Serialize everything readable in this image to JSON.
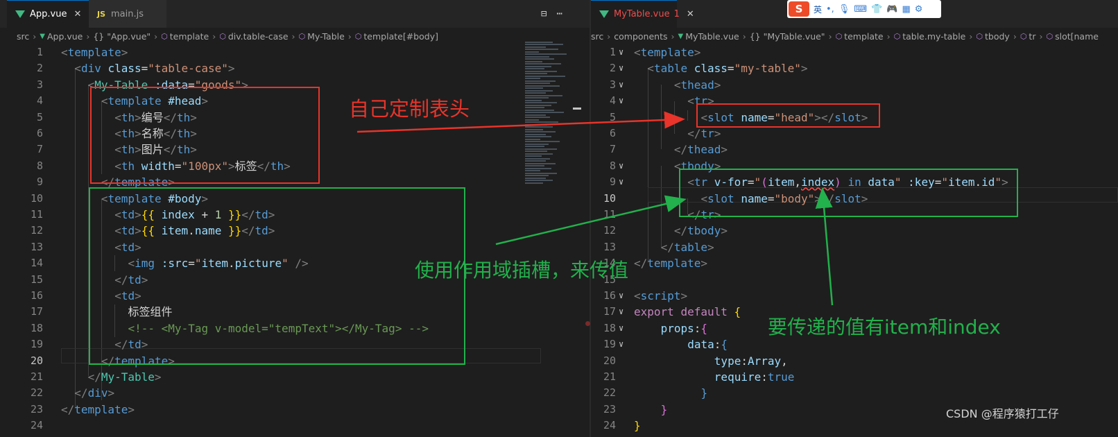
{
  "left": {
    "tabs": [
      {
        "label": "App.vue",
        "active": true,
        "close": "✕"
      },
      {
        "label": "main.js",
        "active": false
      }
    ],
    "breadcrumbs": [
      "src",
      "App.vue",
      "{} \"App.vue\"",
      "template",
      "div.table-case",
      "My-Table",
      "template[#body]"
    ],
    "current_line": 20
  },
  "right": {
    "tabs": [
      {
        "label": "MyTable.vue",
        "badge": "1",
        "active": true,
        "close": "✕"
      }
    ],
    "breadcrumbs": [
      "src",
      "components",
      "MyTable.vue",
      "{} \"MyTable.vue\"",
      "template",
      "table.my-table",
      "tbody",
      "tr",
      "slot[name"
    ],
    "current_line": 10
  },
  "annotations": {
    "head_label": "自己定制表头",
    "scope_label": "使用作用域插槽，来传值",
    "values_label": "要传递的值有item和index"
  },
  "watermark": "CSDN @程序猿打工仔",
  "ime": {
    "lang": "英",
    "punct": "•,"
  },
  "colors": {
    "annotation_red": "#e8342a",
    "annotation_green": "#22b14c",
    "editor_bg": "#1e1e1e"
  }
}
